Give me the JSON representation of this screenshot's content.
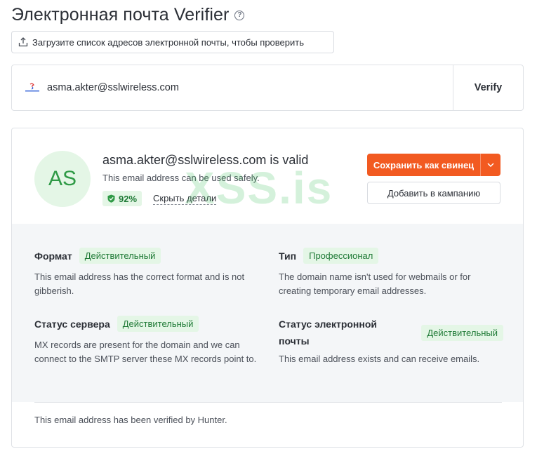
{
  "page": {
    "title": "Электронная почта Verifier",
    "help_icon": "question-circle-icon"
  },
  "upload": {
    "label": "Загрузите список адресов электронной почты, чтобы проверить",
    "icon": "upload-icon"
  },
  "verify": {
    "email_value": "asma.akter@sslwireless.com",
    "button_label": "Verify",
    "logo_icon": "company-logo"
  },
  "result": {
    "avatar_initials": "AS",
    "title": "asma.akter@sslwireless.com is valid",
    "subtitle": "This email address can be used safely.",
    "score": "92%",
    "score_icon": "shield-check-icon",
    "details_link": "Скрыть детали",
    "save_lead_label": "Сохранить как свинец",
    "add_campaign_label": "Добавить в кампанию",
    "watermark": "XSS.is"
  },
  "checks": [
    {
      "label": "Формат",
      "status": "Действительный",
      "description": "This email address has the correct format and is not gibberish."
    },
    {
      "label": "Тип",
      "status": "Профессионал",
      "description": "The domain name isn't used for webmails or for creating temporary email addresses."
    },
    {
      "label": "Статус сервера",
      "status": "Действительный",
      "description": "MX records are present for the domain and we can connect to the SMTP server these MX records point to."
    },
    {
      "label": "Статус электронной почты",
      "status": "Действительный",
      "description": "This email address exists and can receive emails."
    }
  ],
  "footer": {
    "note": "This email address has been verified by Hunter."
  },
  "colors": {
    "accent": "#f25a21",
    "valid_bg": "#e4f6e6",
    "valid_text": "#1f7a36"
  }
}
